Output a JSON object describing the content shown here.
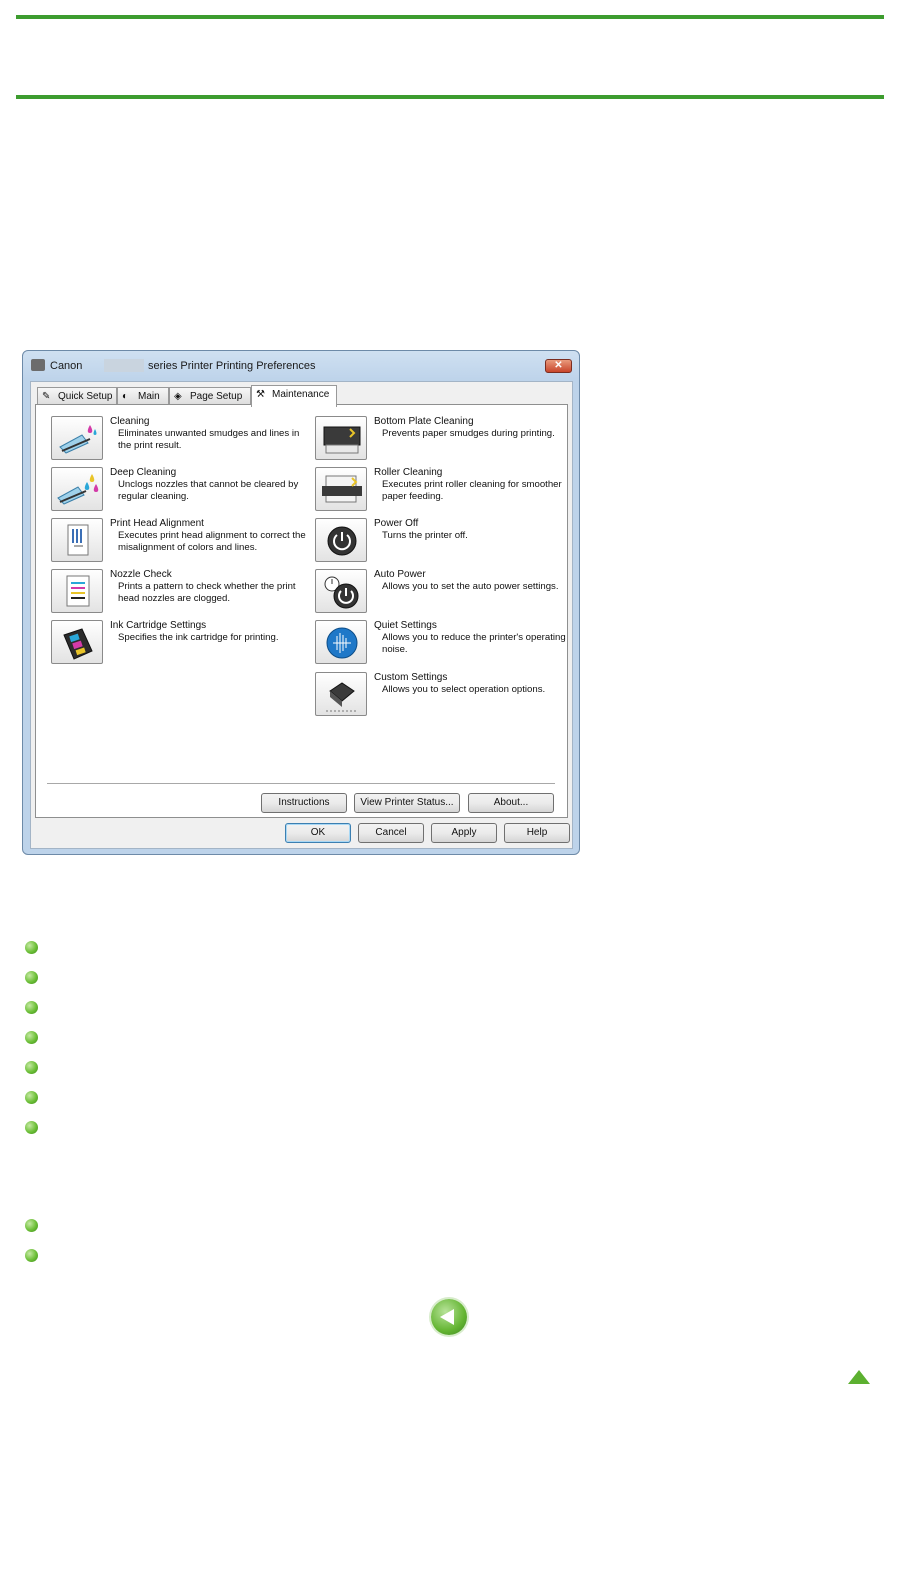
{
  "dialog": {
    "title_prefix": "Canon",
    "title_suffix": "series Printer Printing Preferences",
    "close_label": "✕",
    "tabs": [
      {
        "label": "Quick Setup"
      },
      {
        "label": "Main"
      },
      {
        "label": "Page Setup"
      },
      {
        "label": "Maintenance"
      }
    ],
    "left_items": [
      {
        "title": "Cleaning",
        "desc": "Eliminates unwanted smudges and lines in the print result."
      },
      {
        "title": "Deep Cleaning",
        "desc": "Unclogs nozzles that cannot be cleared by regular cleaning."
      },
      {
        "title": "Print Head Alignment",
        "desc": "Executes print head alignment to correct the misalignment of colors and lines."
      },
      {
        "title": "Nozzle Check",
        "desc": "Prints a pattern to check whether the print head nozzles are clogged."
      },
      {
        "title": "Ink Cartridge Settings",
        "desc": "Specifies the ink cartridge for printing."
      }
    ],
    "right_items": [
      {
        "title": "Bottom Plate Cleaning",
        "desc": "Prevents paper smudges during printing."
      },
      {
        "title": "Roller Cleaning",
        "desc": "Executes print roller cleaning for smoother paper feeding."
      },
      {
        "title": "Power Off",
        "desc": "Turns the printer off."
      },
      {
        "title": "Auto Power",
        "desc": "Allows you to set the auto power settings."
      },
      {
        "title": "Quiet Settings",
        "desc": "Allows you to reduce the printer's operating noise."
      },
      {
        "title": "Custom Settings",
        "desc": "Allows you to select operation options."
      }
    ],
    "panel_buttons": {
      "instructions": "Instructions",
      "view_status": "View Printer Status...",
      "about": "About..."
    },
    "footer_buttons": {
      "ok": "OK",
      "cancel": "Cancel",
      "apply": "Apply",
      "help": "Help"
    }
  },
  "colors": {
    "rule": "#3d9c2f",
    "bullet": "#6cbf37"
  },
  "icons": {
    "bullet": "green-bullet-icon",
    "back": "back-arrow-icon",
    "top": "page-top-icon"
  }
}
